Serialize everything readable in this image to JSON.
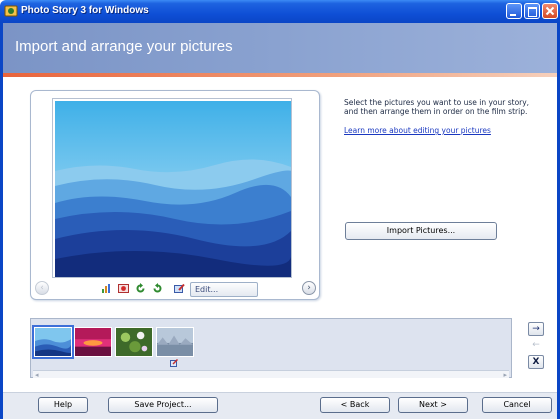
{
  "window": {
    "title": "Photo Story 3 for Windows"
  },
  "header": {
    "title": "Import and arrange your pictures"
  },
  "instructions": {
    "text": "Select the pictures you want to use in your story, and then arrange them in order on the film strip.",
    "link": "Learn more about editing your pictures"
  },
  "buttons": {
    "import": "Import Pictures...",
    "edit": "Edit...",
    "help": "Help",
    "save": "Save Project...",
    "back": "< Back",
    "next": "Next >",
    "cancel": "Cancel"
  },
  "navigation": {
    "prev": "‹",
    "next": "›",
    "move_right": "→",
    "move_left": "←",
    "remove": "X"
  },
  "filmstrip": {
    "selected_index": 0,
    "thumbnails": [
      "blue-mountains",
      "red-sunset",
      "green-flowers",
      "misty-forest"
    ]
  },
  "colors": {
    "titlebar": "#0f4fd6",
    "header": "#8aa2d0",
    "accent_line": "#e8643c",
    "link": "#1a38c0"
  },
  "icons": [
    "app-icon",
    "rotate-left-icon",
    "rotate-right-icon",
    "auto-fix-icon",
    "red-eye-icon",
    "edit-icon"
  ]
}
